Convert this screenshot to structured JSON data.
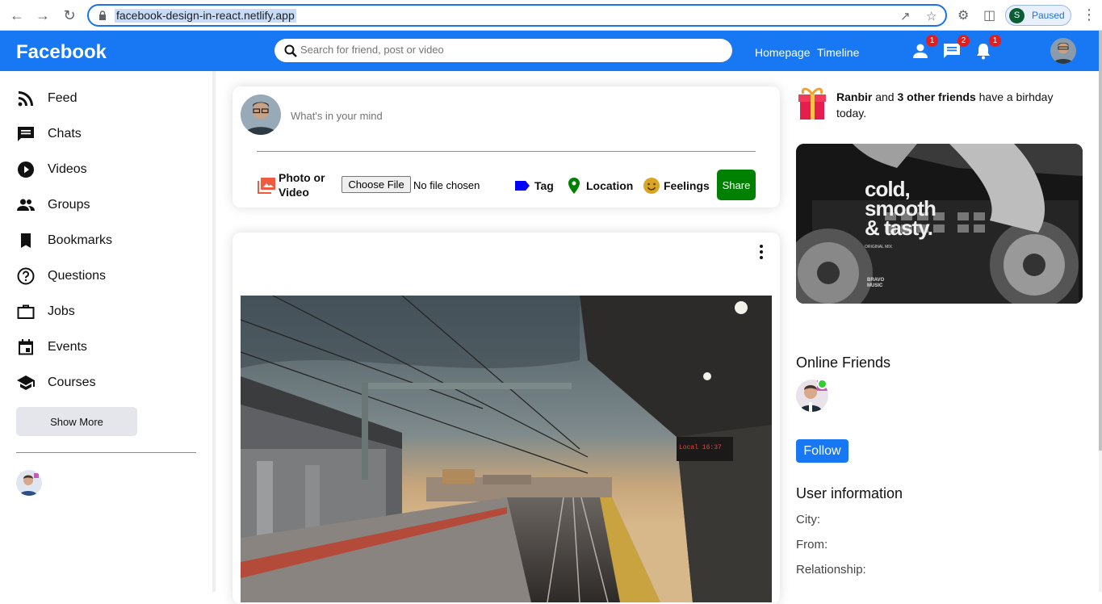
{
  "browser": {
    "url": "facebook-design-in-react.netlify.app",
    "profile_initial": "S",
    "profile_status": "Paused"
  },
  "header": {
    "logo": "Facebook",
    "search_placeholder": "Search for friend, post or video",
    "links": [
      "Homepage",
      "Timeline"
    ],
    "badges": {
      "friends": "1",
      "messages": "2",
      "notifications": "1"
    }
  },
  "sidebar": {
    "items": [
      {
        "label": "Feed",
        "icon": "rss-feed-icon"
      },
      {
        "label": "Chats",
        "icon": "chat-icon"
      },
      {
        "label": "Videos",
        "icon": "play-circle-icon"
      },
      {
        "label": "Groups",
        "icon": "group-icon"
      },
      {
        "label": "Bookmarks",
        "icon": "bookmark-icon"
      },
      {
        "label": "Questions",
        "icon": "help-circle-icon"
      },
      {
        "label": "Jobs",
        "icon": "briefcase-icon"
      },
      {
        "label": "Events",
        "icon": "calendar-icon"
      },
      {
        "label": "Courses",
        "icon": "school-icon"
      }
    ],
    "show_more": "Show More"
  },
  "share": {
    "placeholder": "What's in your mind",
    "photo_label": "Photo or Video",
    "file_button": "Choose File",
    "file_status": "No file chosen",
    "tag": "Tag",
    "location": "Location",
    "feelings": "Feelings",
    "share_button": "Share"
  },
  "rightbar": {
    "bday_name": "Ranbir",
    "bday_mid": " and ",
    "bday_others": "3 other friends",
    "bday_end": " have a birhday today.",
    "ad_line1": "cold,",
    "ad_line2": "smooth",
    "ad_line3": "& tasty.",
    "ad_small": "ORIGINAL MIX",
    "ad_brand": "BRAVO MUSIC",
    "online_title": "Online Friends",
    "follow": "Follow",
    "info_title": "User information",
    "info_city": "City:",
    "info_from": "From:",
    "info_relationship": "Relationship:"
  },
  "colors": {
    "brand": "#1877f2",
    "share": "#008000",
    "badge": "#e41e1e",
    "online": "#32cd32"
  }
}
